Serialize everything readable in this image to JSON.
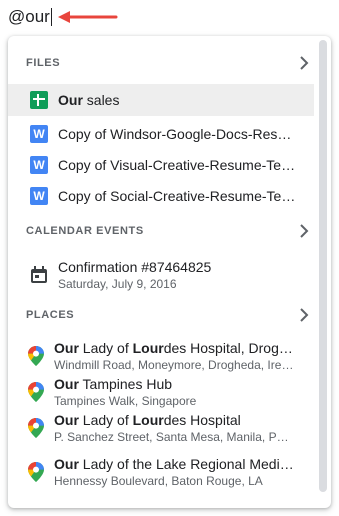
{
  "query": "@our",
  "sections": {
    "files": {
      "title": "FILES"
    },
    "calendar": {
      "title": "CALENDAR EVENTS"
    },
    "places": {
      "title": "PLACES"
    }
  },
  "files": [
    {
      "match": "Our",
      "rest": " sales",
      "icon": "sheets-icon"
    },
    {
      "match": "",
      "rest": "Copy of Windsor-Google-Docs-Resume-Template",
      "icon": "docs-icon"
    },
    {
      "match": "",
      "rest": "Copy of Visual-Creative-Resume-Template",
      "icon": "docs-icon"
    },
    {
      "match": "",
      "rest": "Copy of Social-Creative-Resume-Template",
      "icon": "docs-icon"
    }
  ],
  "event": {
    "title": "Confirmation #87464825",
    "date": "Saturday, July 9, 2016"
  },
  "places": [
    {
      "m1": "Our",
      "t1": " Lady of ",
      "m2": "Lour",
      "t2": "des Hospital, Drogheda",
      "address": "Windmill Road, Moneymore, Drogheda, Ireland"
    },
    {
      "m1": "Our",
      "t1": " Tampines Hub",
      "m2": "",
      "t2": "",
      "address": "Tampines Walk, Singapore"
    },
    {
      "m1": "Our",
      "t1": " Lady of ",
      "m2": "Lour",
      "t2": "des Hospital",
      "address": "P. Sanchez Street, Santa Mesa, Manila, Philippines"
    },
    {
      "m1": "Our",
      "t1": " Lady of the Lake Regional Medical Center",
      "m2": "",
      "t2": "",
      "address": "Hennessy Boulevard, Baton Rouge, LA"
    }
  ],
  "colors": {
    "sheets": "#0f9d58",
    "docs": "#4285f4",
    "arrow": "#e8453c",
    "selected_bg": "#eeeeee"
  }
}
